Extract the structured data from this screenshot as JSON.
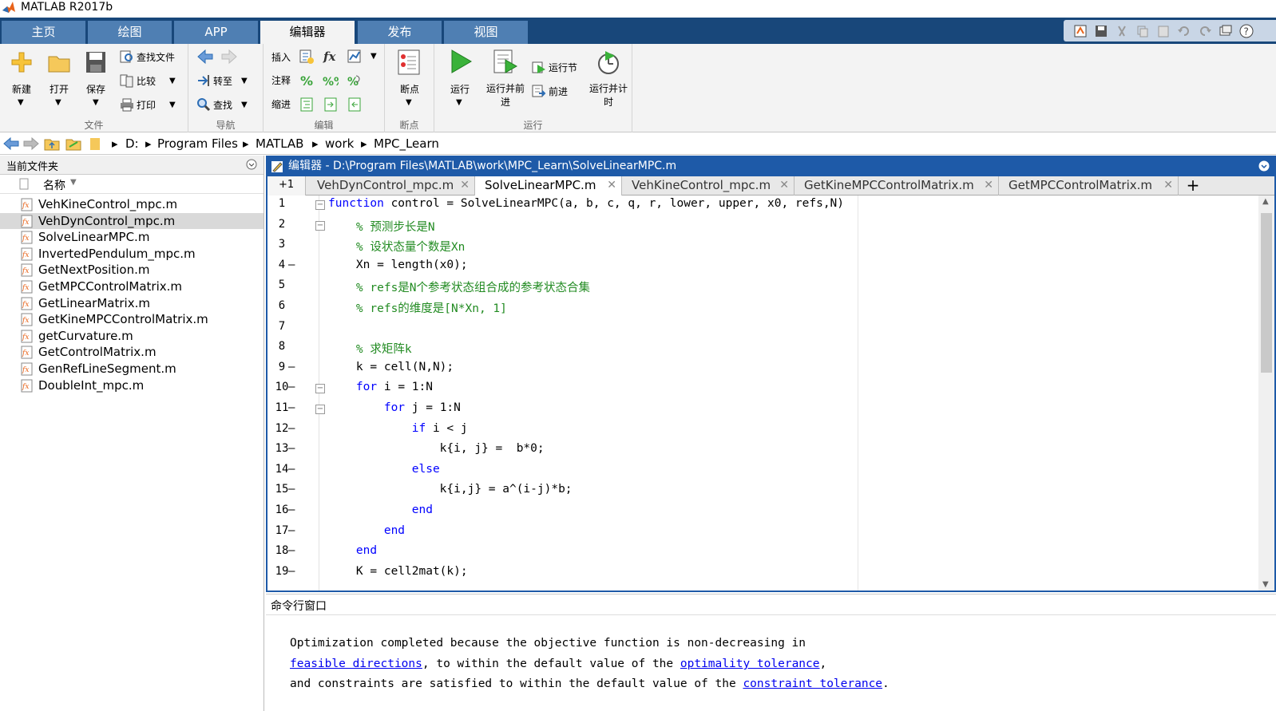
{
  "window": {
    "title": "MATLAB R2017b"
  },
  "ribbon_tabs": [
    "主页",
    "绘图",
    "APP",
    "编辑器",
    "发布",
    "视图"
  ],
  "ribbon": {
    "file": {
      "new": "新建",
      "open": "打开",
      "save": "保存",
      "find_files": "查找文件",
      "compare": "比较",
      "print": "打印",
      "label": "文件"
    },
    "navigate": {
      "goto": "转至",
      "find": "查找",
      "label": "导航"
    },
    "edit": {
      "insert": "插入",
      "comment": "注释",
      "indent": "缩进",
      "label": "编辑"
    },
    "breakpoints": {
      "breakpoints": "断点",
      "label": "断点"
    },
    "run": {
      "run": "运行",
      "run_advance": "运行并前进",
      "run_section": "运行节",
      "advance": "前进",
      "run_time": "运行并计时",
      "label": "运行"
    }
  },
  "address": {
    "crumbs": [
      "D:",
      "Program Files",
      "MATLAB",
      "work",
      "MPC_Learn"
    ]
  },
  "current_folder": {
    "title": "当前文件夹",
    "column": "名称",
    "files": [
      "VehKineControl_mpc.m",
      "VehDynControl_mpc.m",
      "SolveLinearMPC.m",
      "InvertedPendulum_mpc.m",
      "GetNextPosition.m",
      "GetMPCControlMatrix.m",
      "GetLinearMatrix.m",
      "GetKineMPCControlMatrix.m",
      "getCurvature.m",
      "GetControlMatrix.m",
      "GenRefLineSegment.m",
      "DoubleInt_mpc.m"
    ],
    "selected_index": 1
  },
  "editor": {
    "title": "编辑器 - D:\\Program Files\\MATLAB\\work\\MPC_Learn\\SolveLinearMPC.m",
    "plus_one": "+1",
    "tabs": [
      "VehDynControl_mpc.m",
      "SolveLinearMPC.m",
      "VehKineControl_mpc.m",
      "GetKineMPCControlMatrix.m",
      "GetMPCControlMatrix.m"
    ],
    "active_tab": 1,
    "add_tab": "+",
    "lines": [
      {
        "n": "1",
        "dash": "",
        "text": "function control = SolveLinearMPC(a, b, c, q, r, lower, upper, x0, refs,N)"
      },
      {
        "n": "2",
        "dash": "",
        "text": "    % 预测步长是N"
      },
      {
        "n": "3",
        "dash": "",
        "text": "    % 设状态量个数是Xn"
      },
      {
        "n": "4",
        "dash": "—",
        "text": "    Xn = length(x0);"
      },
      {
        "n": "5",
        "dash": "",
        "text": "    % refs是N个参考状态组合成的参考状态合集"
      },
      {
        "n": "6",
        "dash": "",
        "text": "    % refs的维度是[N*Xn, 1]"
      },
      {
        "n": "7",
        "dash": "",
        "text": ""
      },
      {
        "n": "8",
        "dash": "",
        "text": "    % 求矩阵k"
      },
      {
        "n": "9",
        "dash": "—",
        "text": "    k = cell(N,N);"
      },
      {
        "n": "10",
        "dash": "—",
        "text": "    for i = 1:N"
      },
      {
        "n": "11",
        "dash": "—",
        "text": "        for j = 1:N"
      },
      {
        "n": "12",
        "dash": "—",
        "text": "            if i < j"
      },
      {
        "n": "13",
        "dash": "—",
        "text": "                k{i, j} =  b*0;"
      },
      {
        "n": "14",
        "dash": "—",
        "text": "            else"
      },
      {
        "n": "15",
        "dash": "—",
        "text": "                k{i,j} = a^(i-j)*b;"
      },
      {
        "n": "16",
        "dash": "—",
        "text": "            end"
      },
      {
        "n": "17",
        "dash": "—",
        "text": "        end"
      },
      {
        "n": "18",
        "dash": "—",
        "text": "    end"
      },
      {
        "n": "19",
        "dash": "—",
        "text": "    K = cell2mat(k);"
      }
    ]
  },
  "command_window": {
    "title": "命令行窗口",
    "line1": "Optimization completed because the objective function is non-decreasing in",
    "link1": "feasible directions",
    "line2a": ", to within the default value of the ",
    "link2": "optimality tolerance",
    "line2b": ",",
    "line3a": "and constraints are satisfied to within the default value of the ",
    "link3": "constraint tolerance",
    "line3b": "."
  },
  "colors": {
    "tabbar": "#18477a",
    "tab": "#4f7fb3",
    "keyword": "#0000ff",
    "comment": "#228b22",
    "editor_border": "#1e5aa8"
  }
}
